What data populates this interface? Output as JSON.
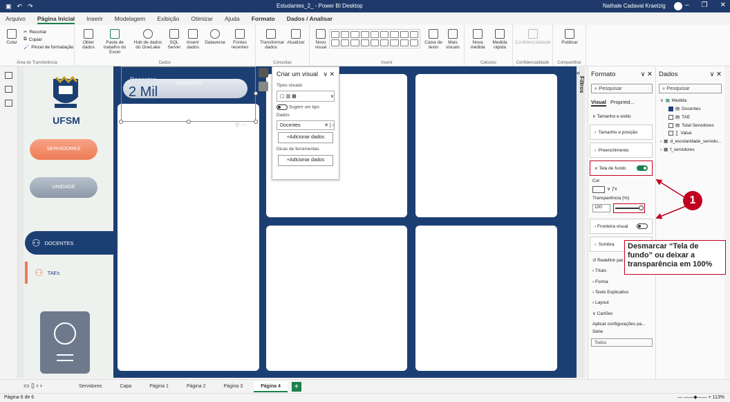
{
  "window": {
    "title": "Estudantes_2_ - Power BI Desktop",
    "user": "Nathale Cadaval Kraetzig"
  },
  "menu": {
    "tabs": [
      "Arquivo",
      "Página Inicial",
      "Inserir",
      "Modelagem",
      "Exibição",
      "Otimizar",
      "Ajuda",
      "Formato",
      "Dados / Analisar"
    ]
  },
  "ribbon": {
    "clipboard": {
      "colar": "Colar",
      "recortar": "Recortar",
      "copiar": "Copiar",
      "pincel": "Pincel de formatação",
      "group": "Área de Transferência"
    },
    "dados": {
      "obter": "Obter dados",
      "excel": "Pasta de trabalho do Excel",
      "onelake": "Hub de dados do OneLake",
      "sql": "SQL Server",
      "inserir": "Inserir dados",
      "dataverse": "Dataverse",
      "fontes": "Fontes recentes",
      "group": "Dados"
    },
    "consultas": {
      "transformar": "Transformar dados",
      "atualizar": "Atualizar",
      "group": "Consultas"
    },
    "inserir": {
      "novo": "Novo visual",
      "caixa": "Caixa de texto",
      "mais": "Mais visuais",
      "group": "Inserir"
    },
    "calculos": {
      "nova": "Nova medida",
      "rapida": "Medida rápida",
      "group": "Cálculos"
    },
    "confid": {
      "label": "Confidencialidade",
      "group": "Confidencialidade"
    },
    "compartilhar": {
      "publicar": "Publicar",
      "group": "Compartilhar"
    }
  },
  "report": {
    "ufsm": "UFSM",
    "servidores_btn": "SERVIDORES",
    "unidade_btn": "UNIDADE",
    "docentes_tab": "DOCENTES",
    "taes_tab": "TAEs",
    "card_label_faded": "Docentes",
    "card_label": "DOCENTES",
    "card_value": "2 Mil"
  },
  "create_visual": {
    "title": "Criar um visual",
    "tipos": "Tipos visuais",
    "sugerir": "Sugerir um tipo",
    "dados": "Dados",
    "docentes_field": "Docentes",
    "add_dados": "+Adicionar dados",
    "dicas": "Dicas de ferramentas",
    "add_dados2": "+Adicionar dados"
  },
  "filtros": "Filtros",
  "format_pane": {
    "title": "Formato",
    "search_placeholder": "Pesquisar",
    "tab_visual": "Visual",
    "tab_propriedades": "Propried...",
    "tamanho_estilo": "Tamanho e estilo",
    "tamanho_posicao": "Tamanho e posição",
    "preenchimento": "Preenchimento",
    "tela_de_fundo": "Tela de fundo",
    "cor": "Cor",
    "transparencia_label": "Transparência (%)",
    "transparencia_value": "100",
    "fronteira": "Fronteira visual",
    "sombra": "Sombra",
    "redefinir": "Redefinir par...",
    "titulo": "Título",
    "forma": "Forma",
    "texto_explicativo": "Texto Explicativo",
    "layout": "Layout",
    "cartoes": "Cartões",
    "aplicar": "Aplicar configurações pa...",
    "serie": "Série",
    "serie_value": "Todos"
  },
  "data_pane": {
    "title": "Dados",
    "search_placeholder": "Pesquisar",
    "medida": "Medida",
    "items": [
      "Docentes",
      "TAE",
      "Total Servidores",
      "Value"
    ],
    "tables": [
      "d_escolaridade_servido...",
      "f_servidores"
    ]
  },
  "annotation": {
    "number": "1",
    "note": "Desmarcar “Tela de fundo” ou deixar a transparência em 100%"
  },
  "pages": {
    "tabs": [
      "Servidores",
      "Capa",
      "Página 1",
      "Página 2",
      "Página 3",
      "Página 4"
    ],
    "active": "Página 4",
    "add": "+"
  },
  "status": {
    "page": "Página 6 de 6",
    "zoom": "113%"
  },
  "colors": {
    "report_navy": "#1c3f73",
    "accent_green": "#1a7f4b",
    "annotation_red": "#c0001f",
    "orange": "#ee7a55"
  }
}
